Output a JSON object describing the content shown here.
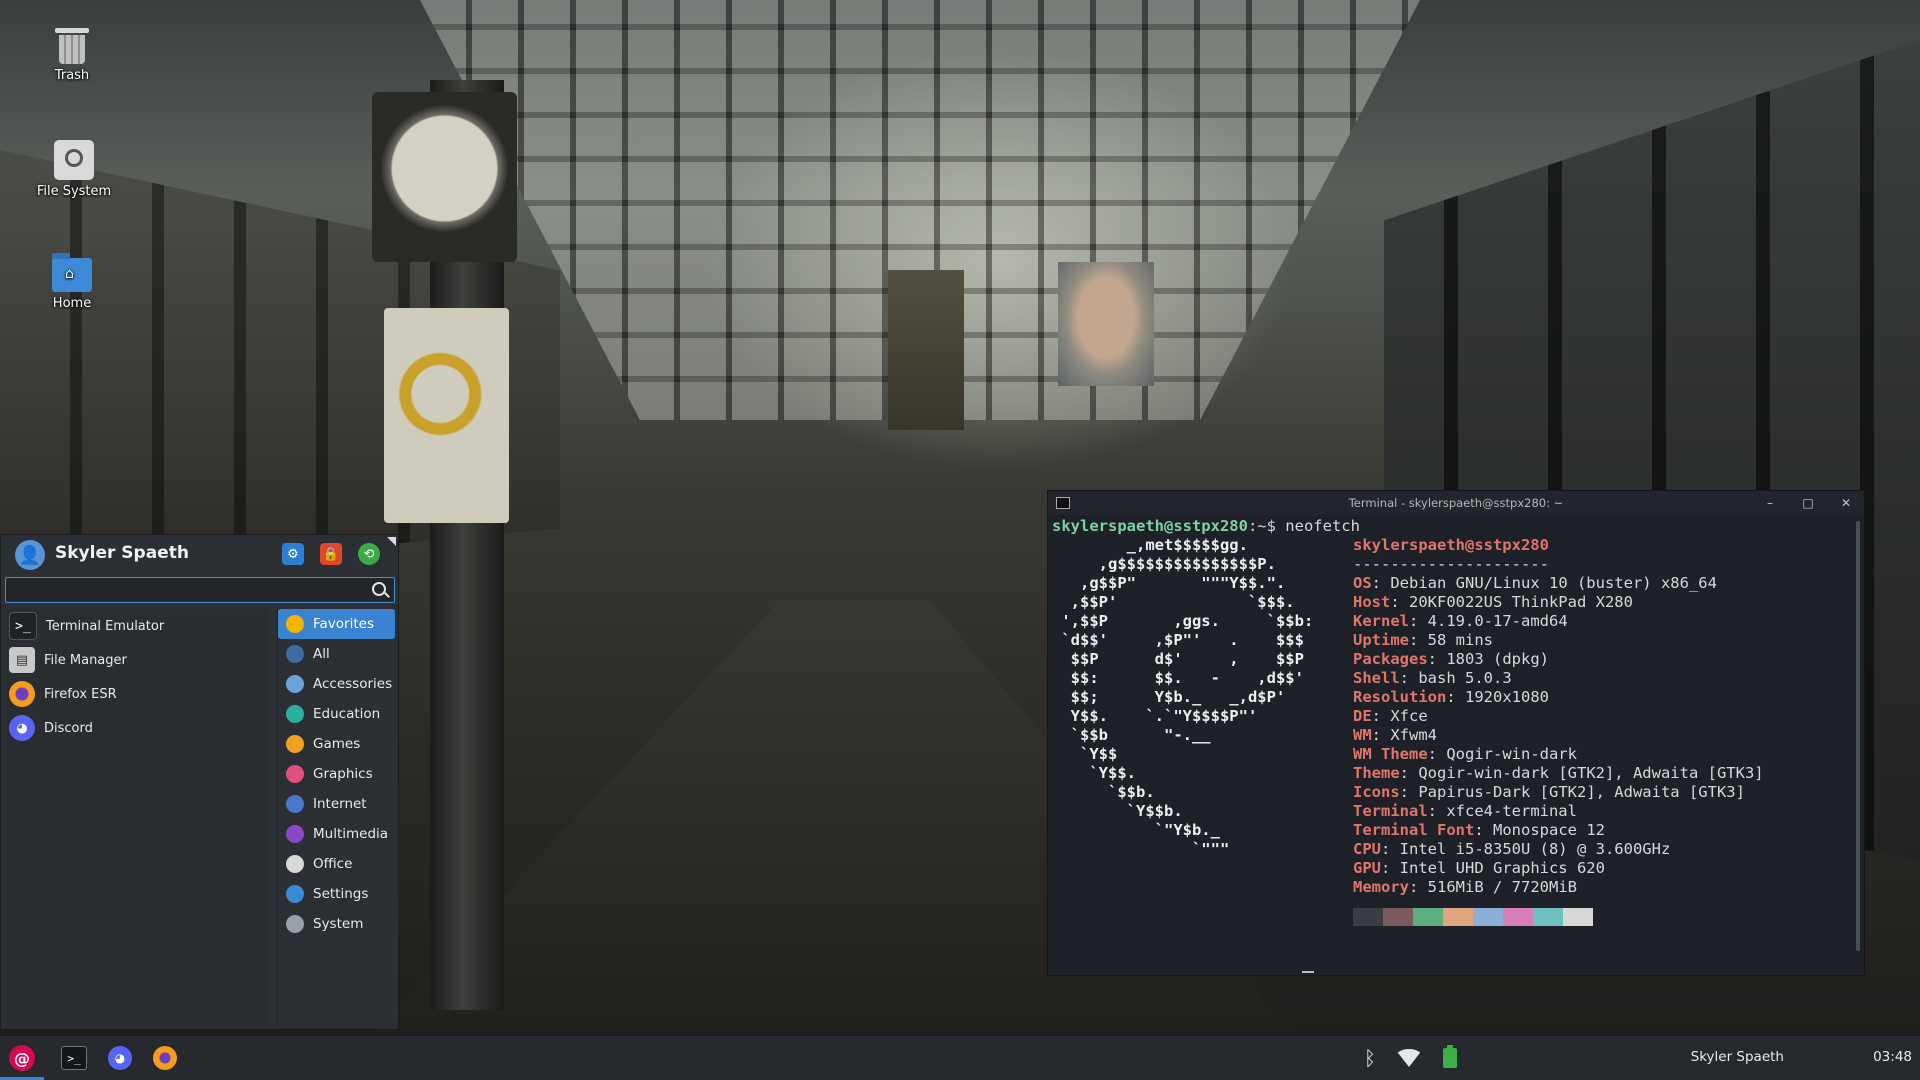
{
  "desktop": {
    "icons": [
      {
        "label": "Trash"
      },
      {
        "label": "File System"
      },
      {
        "label": "Home"
      }
    ]
  },
  "menu": {
    "user": "Skyler Spaeth",
    "search": {
      "placeholder": "",
      "value": ""
    },
    "apps": [
      {
        "label": "Terminal Emulator",
        "icon": "terminal-icon"
      },
      {
        "label": "File Manager",
        "icon": "file-manager-icon"
      },
      {
        "label": "Firefox ESR",
        "icon": "firefox-icon"
      },
      {
        "label": "Discord",
        "icon": "discord-icon"
      }
    ],
    "categories": [
      {
        "label": "Favorites",
        "color": "#f4b400",
        "active": true
      },
      {
        "label": "All",
        "color": "#3a6ea5"
      },
      {
        "label": "Accessories",
        "color": "#6aa3d9"
      },
      {
        "label": "Education",
        "color": "#2ab0a0"
      },
      {
        "label": "Games",
        "color": "#f0a020"
      },
      {
        "label": "Graphics",
        "color": "#e05080"
      },
      {
        "label": "Internet",
        "color": "#4a78d0"
      },
      {
        "label": "Multimedia",
        "color": "#8a4ac8"
      },
      {
        "label": "Office",
        "color": "#d8d8d8"
      },
      {
        "label": "Settings",
        "color": "#3a8ad8"
      },
      {
        "label": "System",
        "color": "#9aa0a8"
      }
    ]
  },
  "terminal": {
    "title": "Terminal - skylerspaeth@sstpx280: ~",
    "prompt_user": "skylerspaeth@sstpx280",
    "prompt_rest": ":~$ neofetch",
    "host_header": "skylerspaeth@sstpx280",
    "separator": "---------------------",
    "logo": "        _,met$$$$$gg.\n     ,g$$$$$$$$$$$$$$$P.\n   ,g$$P\"       \"\"\"Y$$.\".\n  ,$$P'              `$$$.\n ',$$P       ,ggs.     `$$b:\n `d$$'     ,$P\"'   .    $$$\n  $$P      d$'     ,    $$P\n  $$:      $$.   -    ,d$$'\n  $$;      Y$b._   _,d$P'\n  Y$$.    `.`\"Y$$$$P\"'\n  `$$b      \"-.__\n   `Y$$\n    `Y$$.\n      `$$b.\n        `Y$$b.\n           `\"Y$b._\n               `\"\"\"",
    "info": [
      {
        "key": "OS",
        "value": "Debian GNU/Linux 10 (buster) x86_64"
      },
      {
        "key": "Host",
        "value": "20KF0022US ThinkPad X280"
      },
      {
        "key": "Kernel",
        "value": "4.19.0-17-amd64"
      },
      {
        "key": "Uptime",
        "value": "58 mins"
      },
      {
        "key": "Packages",
        "value": "1803 (dpkg)"
      },
      {
        "key": "Shell",
        "value": "bash 5.0.3"
      },
      {
        "key": "Resolution",
        "value": "1920x1080"
      },
      {
        "key": "DE",
        "value": "Xfce"
      },
      {
        "key": "WM",
        "value": "Xfwm4"
      },
      {
        "key": "WM Theme",
        "value": "Qogir-win-dark"
      },
      {
        "key": "Theme",
        "value": "Qogir-win-dark [GTK2], Adwaita [GTK3]"
      },
      {
        "key": "Icons",
        "value": "Papirus-Dark [GTK2], Adwaita [GTK3]"
      },
      {
        "key": "Terminal",
        "value": "xfce4-terminal"
      },
      {
        "key": "Terminal Font",
        "value": "Monospace 12"
      },
      {
        "key": "CPU",
        "value": "Intel i5-8350U (8) @ 3.600GHz"
      },
      {
        "key": "GPU",
        "value": "Intel UHD Graphics 620"
      },
      {
        "key": "Memory",
        "value": "516MiB / 7720MiB"
      }
    ],
    "palette": [
      "#3a3e44",
      "#7d5a5d",
      "#5fae7e",
      "#e0a57e",
      "#8aaed6",
      "#d77fb6",
      "#6cc0be",
      "#d8d8d8"
    ]
  },
  "taskbar": {
    "launchers": [
      "debian-menu-icon",
      "terminal-icon",
      "discord-icon",
      "firefox-icon"
    ],
    "tray": [
      "bluetooth-icon",
      "wifi-icon",
      "battery-icon"
    ],
    "user": "Skyler Spaeth",
    "time": "03:48"
  }
}
